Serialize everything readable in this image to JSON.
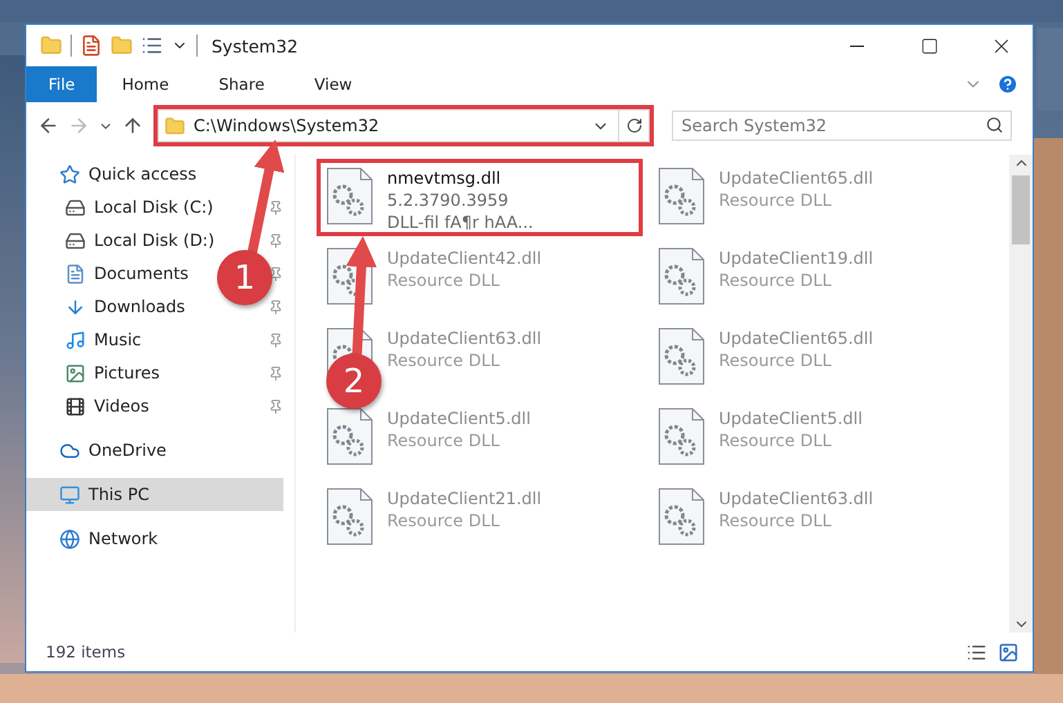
{
  "window": {
    "title": "System32"
  },
  "ribbon_tabs": [
    {
      "label": "File",
      "kind": "file"
    },
    {
      "label": "Home",
      "kind": "tab"
    },
    {
      "label": "Share",
      "kind": "tab"
    },
    {
      "label": "View",
      "kind": "tab"
    }
  ],
  "address_bar": {
    "path": "C:\\Windows\\System32",
    "highlighted": true
  },
  "search": {
    "placeholder": "Search System32"
  },
  "sidebar": {
    "items": [
      {
        "label": "Quick access",
        "kind": "star",
        "selected": false,
        "children": [
          {
            "label": "Local Disk (C:)",
            "kind": "drive",
            "pinned": true,
            "selected": false
          },
          {
            "label": "Local Disk (D:)",
            "kind": "drive",
            "pinned": true,
            "selected": false
          },
          {
            "label": "Documents",
            "kind": "documents",
            "pinned": true,
            "selected": false
          },
          {
            "label": "Downloads",
            "kind": "downloads",
            "pinned": true,
            "selected": false
          },
          {
            "label": "Music",
            "kind": "music",
            "pinned": true,
            "selected": false
          },
          {
            "label": "Pictures",
            "kind": "pictures",
            "pinned": true,
            "selected": false
          },
          {
            "label": "Videos",
            "kind": "videos",
            "pinned": true,
            "selected": false
          }
        ]
      },
      {
        "label": "OneDrive",
        "kind": "cloud",
        "selected": false
      },
      {
        "label": "This PC",
        "kind": "pc",
        "selected": true
      },
      {
        "label": "Network",
        "kind": "network",
        "selected": false
      }
    ]
  },
  "files": [
    {
      "name": "nmevtmsg.dll",
      "details": [
        "5.2.3790.3959",
        "DLL-fil fA¶r hAA..."
      ],
      "dimmed": false,
      "highlighted": true
    },
    {
      "name": "UpdateClient65.dll",
      "details": [
        "Resource DLL"
      ],
      "dimmed": true,
      "highlighted": false
    },
    {
      "name": "UpdateClient42.dll",
      "details": [
        "Resource DLL"
      ],
      "dimmed": true,
      "highlighted": false
    },
    {
      "name": "UpdateClient19.dll",
      "details": [
        "Resource DLL"
      ],
      "dimmed": true,
      "highlighted": false
    },
    {
      "name": "UpdateClient63.dll",
      "details": [
        "Resource DLL"
      ],
      "dimmed": true,
      "highlighted": false
    },
    {
      "name": "UpdateClient65.dll",
      "details": [
        "Resource DLL"
      ],
      "dimmed": true,
      "highlighted": false
    },
    {
      "name": "UpdateClient5.dll",
      "details": [
        "Resource DLL"
      ],
      "dimmed": true,
      "highlighted": false
    },
    {
      "name": "UpdateClient5.dll",
      "details": [
        "Resource DLL"
      ],
      "dimmed": true,
      "highlighted": false
    },
    {
      "name": "UpdateClient21.dll",
      "details": [
        "Resource DLL"
      ],
      "dimmed": true,
      "highlighted": false
    },
    {
      "name": "UpdateClient63.dll",
      "details": [
        "Resource DLL"
      ],
      "dimmed": true,
      "highlighted": false
    }
  ],
  "status_bar": {
    "item_count": "192 items"
  },
  "callouts": [
    {
      "number": "1"
    },
    {
      "number": "2"
    }
  ]
}
